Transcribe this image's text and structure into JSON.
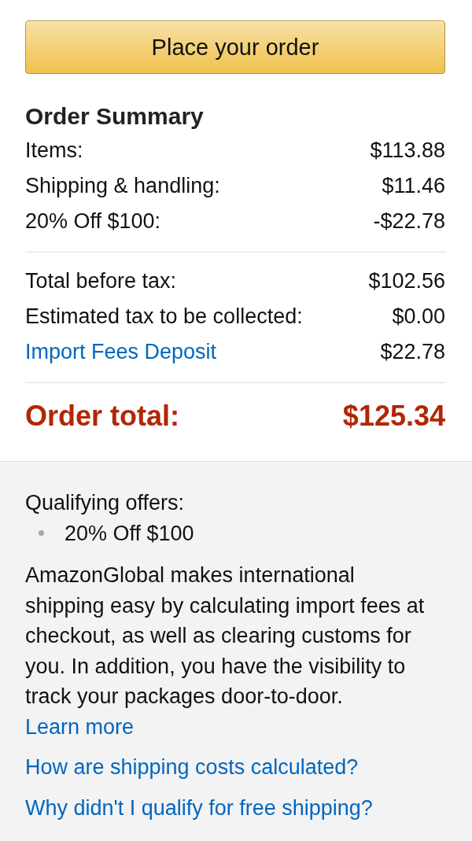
{
  "place_order_button": {
    "label": "Place your order"
  },
  "order_summary": {
    "title": "Order Summary",
    "groups": [
      {
        "rows": [
          {
            "kind": "plain",
            "label": "Items:",
            "amount": "$113.88"
          },
          {
            "kind": "plain",
            "label": "Shipping & handling:",
            "amount": "$11.46"
          },
          {
            "kind": "plain",
            "label": "20% Off $100:",
            "amount": "-$22.78"
          }
        ]
      },
      {
        "rows": [
          {
            "kind": "plain",
            "label": "Total before tax:",
            "amount": "$102.56"
          },
          {
            "kind": "plain",
            "label": "Estimated tax to be collected:",
            "amount": "$0.00"
          },
          {
            "kind": "link",
            "label": "Import Fees Deposit",
            "amount": "$22.78"
          }
        ]
      }
    ]
  },
  "order_total": {
    "label": "Order total:",
    "amount": "$125.34"
  },
  "qualifying_offers": {
    "title": "Qualifying offers:",
    "items": [
      "20% Off $100"
    ]
  },
  "info": {
    "text": "AmazonGlobal makes international shipping easy by calculating import fees at checkout, as well as clearing customs for you. In addition, you have the visibility to track your packages door-to-door.",
    "link": "Learn more"
  },
  "help_links": [
    "How are shipping costs calculated?",
    "Why didn't I qualify for free shipping?"
  ]
}
